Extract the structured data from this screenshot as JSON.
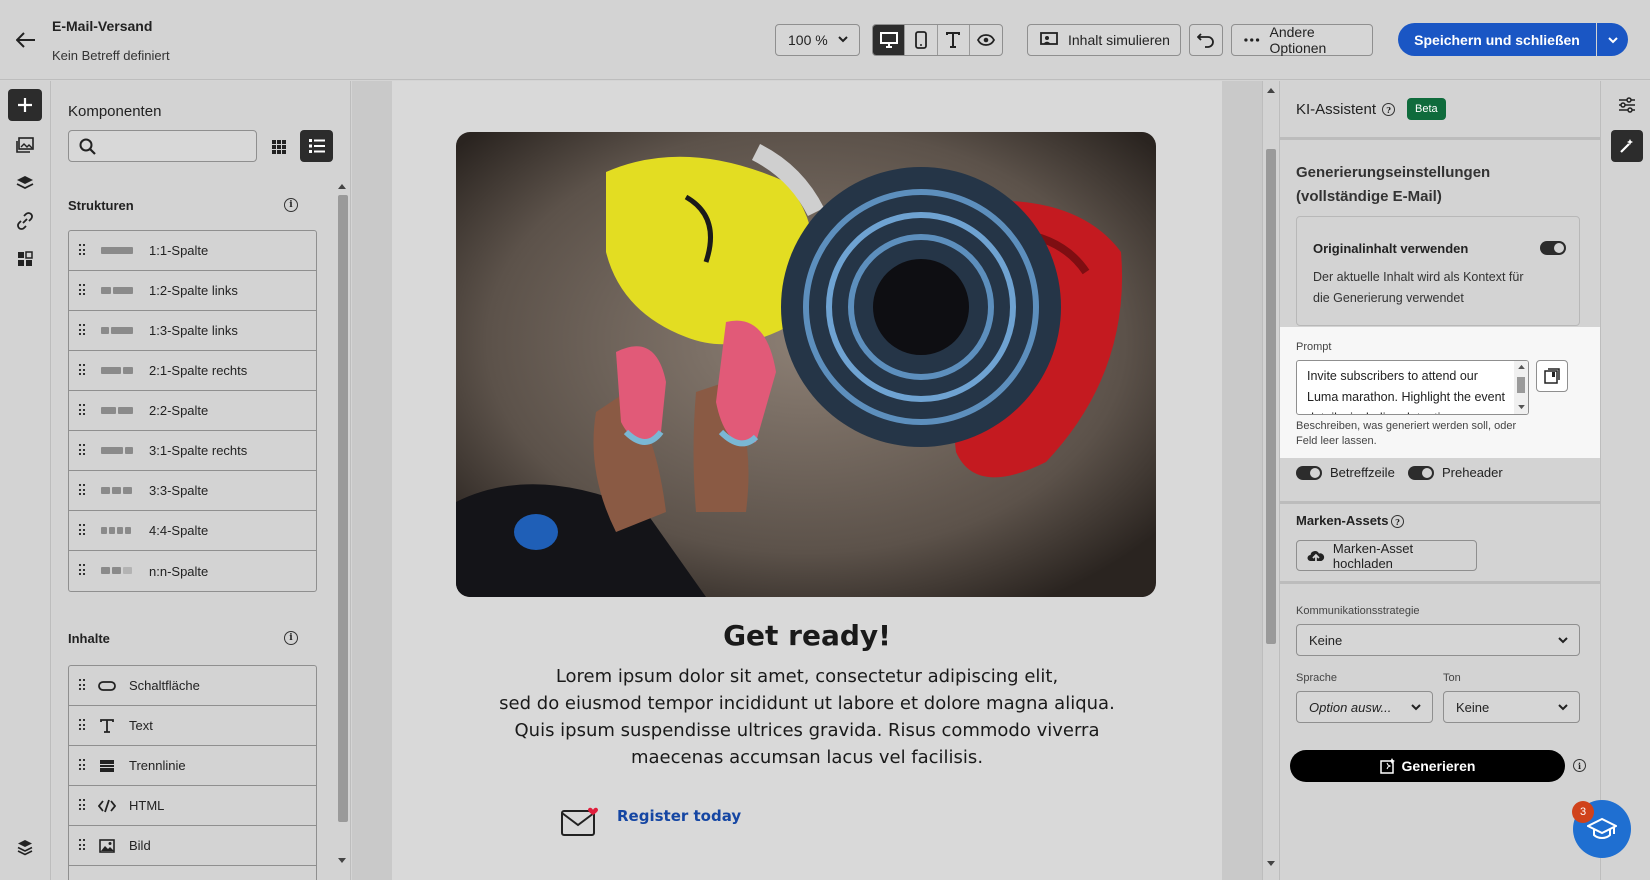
{
  "header": {
    "title": "E-Mail-Versand",
    "subtitle": "Kein Betreff definiert",
    "zoom": "100 %",
    "simulate_label": "Inhalt simulieren",
    "more_label": "Andere Optionen",
    "save_label": "Speichern und schließen"
  },
  "components": {
    "title": "Komponenten",
    "search_placeholder": "",
    "structures_title": "Strukturen",
    "structures": [
      {
        "label": "1:1-Spalte"
      },
      {
        "label": "1:2-Spalte links"
      },
      {
        "label": "1:3-Spalte links"
      },
      {
        "label": "2:1-Spalte rechts"
      },
      {
        "label": "2:2-Spalte"
      },
      {
        "label": "3:1-Spalte rechts"
      },
      {
        "label": "3:3-Spalte"
      },
      {
        "label": "4:4-Spalte"
      },
      {
        "label": "n:n-Spalte"
      }
    ],
    "contents_title": "Inhalte",
    "contents": [
      {
        "label": "Schaltfläche",
        "icon": "button-icon"
      },
      {
        "label": "Text",
        "icon": "text-icon"
      },
      {
        "label": "Trennlinie",
        "icon": "divider-icon"
      },
      {
        "label": "HTML",
        "icon": "code-icon"
      },
      {
        "label": "Bild",
        "icon": "image-icon"
      }
    ]
  },
  "email": {
    "heading": "Get ready!",
    "body_lines": [
      "Lorem ipsum dolor sit amet, consectetur adipiscing elit,",
      "sed do eiusmod tempor incididunt ut labore et dolore magna aliqua.",
      "Quis ipsum suspendisse ultrices gravida. Risus commodo viverra",
      "maecenas accumsan lacus vel facilisis."
    ],
    "register_link": "Register today"
  },
  "ai": {
    "title": "KI-Assistent",
    "beta": "Beta",
    "gen_title_1": "Generierungseinstellungen",
    "gen_title_2": "(vollständige E-Mail)",
    "original_title": "Originalinhalt verwenden",
    "original_desc": "Der aktuelle Inhalt wird als Kontext für die Generierung verwendet",
    "prompt_label": "Prompt",
    "prompt_text": "Invite subscribers to attend our Luma marathon. Highlight the event details, including date, time",
    "prompt_help": "Beschreiben, was generiert werden soll, oder Feld leer lassen.",
    "subject_toggle": "Betreffzeile",
    "preheader_toggle": "Preheader",
    "brand_title": "Marken-Assets",
    "brand_upload": "Marken-Asset hochladen",
    "strategy_label": "Kommunikationsstrategie",
    "strategy_value": "Keine",
    "language_label": "Sprache",
    "language_value": "Option ausw...",
    "tone_label": "Ton",
    "tone_value": "Keine",
    "generate_label": "Generieren"
  },
  "notifications": {
    "count": "3"
  },
  "colors": {
    "accent": "#1a56c4",
    "beta": "#0f6b3c",
    "link": "#1546a3"
  }
}
